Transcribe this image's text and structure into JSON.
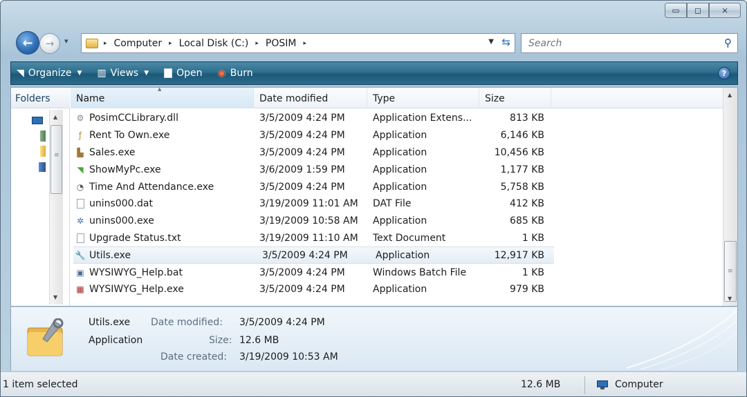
{
  "window": {
    "minimize_glyph": "▭",
    "maximize_glyph": "◻",
    "close_glyph": "⨯"
  },
  "nav": {
    "back_glyph": "←",
    "forward_glyph": "→",
    "recent_glyph": "▾",
    "breadcrumbs": [
      "Computer",
      "Local Disk (C:)",
      "POSIM"
    ],
    "separator": "▸",
    "search_placeholder": "Search"
  },
  "toolbar": {
    "organize": "Organize",
    "views": "Views",
    "open": "Open",
    "burn": "Burn",
    "help": "?"
  },
  "nav_pane": {
    "label": "Folders"
  },
  "columns": {
    "name": "Name",
    "date": "Date modified",
    "type": "Type",
    "size": "Size"
  },
  "files": [
    {
      "name": "PosimCCLibrary.dll",
      "date": "3/5/2009 4:24 PM",
      "type": "Application Extens...",
      "size": "813 KB",
      "icon": "dll-icon"
    },
    {
      "name": "Rent To Own.exe",
      "date": "3/5/2009 4:24 PM",
      "type": "Application",
      "size": "6,146 KB",
      "icon": "rent-to-own-icon"
    },
    {
      "name": "Sales.exe",
      "date": "3/5/2009 4:24 PM",
      "type": "Application",
      "size": "10,456 KB",
      "icon": "sales-icon"
    },
    {
      "name": "ShowMyPc.exe",
      "date": "3/6/2009 1:59 PM",
      "type": "Application",
      "size": "1,177 KB",
      "icon": "showmypc-icon"
    },
    {
      "name": "Time And Attendance.exe",
      "date": "3/5/2009 4:24 PM",
      "type": "Application",
      "size": "5,758 KB",
      "icon": "clock-icon"
    },
    {
      "name": "unins000.dat",
      "date": "3/19/2009 11:01 AM",
      "type": "DAT File",
      "size": "412 KB",
      "icon": "blank-file-icon"
    },
    {
      "name": "unins000.exe",
      "date": "3/19/2009 10:58 AM",
      "type": "Application",
      "size": "685 KB",
      "icon": "uninstall-icon"
    },
    {
      "name": "Upgrade Status.txt",
      "date": "3/19/2009 11:10 AM",
      "type": "Text Document",
      "size": "1 KB",
      "icon": "text-file-icon"
    },
    {
      "name": "Utils.exe",
      "date": "3/5/2009 4:24 PM",
      "type": "Application",
      "size": "12,917 KB",
      "icon": "wrench-icon"
    },
    {
      "name": "WYSIWYG_Help.bat",
      "date": "3/5/2009 4:24 PM",
      "type": "Windows Batch File",
      "size": "1 KB",
      "icon": "batch-file-icon"
    },
    {
      "name": "WYSIWYG_Help.exe",
      "date": "3/5/2009 4:24 PM",
      "type": "Application",
      "size": "979 KB",
      "icon": "help-app-icon"
    }
  ],
  "selected_index": 8,
  "details": {
    "name": "Utils.exe",
    "type": "Application",
    "date_modified_label": "Date modified:",
    "date_modified": "3/5/2009 4:24 PM",
    "size_label": "Size:",
    "size": "12.6 MB",
    "date_created_label": "Date created:",
    "date_created": "3/19/2009 10:53 AM"
  },
  "status": {
    "selection": "1 item selected",
    "size": "12.6 MB",
    "location": "Computer"
  },
  "colors": {
    "toolbar": "#2e6e8e",
    "window_frame": "#b7cfe0",
    "selected_row": "#e4edf5"
  }
}
